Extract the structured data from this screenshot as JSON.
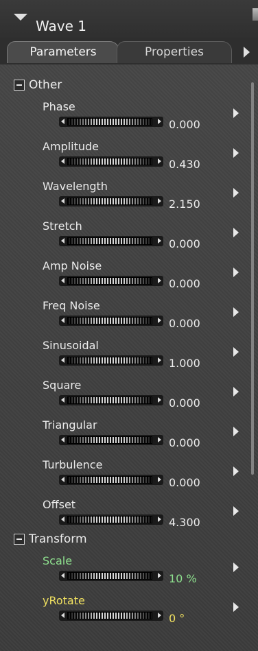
{
  "header": {
    "title": "Wave 1"
  },
  "tabs": [
    {
      "label": "Parameters",
      "active": true
    },
    {
      "label": "Properties",
      "active": false
    }
  ],
  "groups": [
    {
      "label": "Other",
      "params": [
        {
          "label": "Phase",
          "value": "0.000"
        },
        {
          "label": "Amplitude",
          "value": "0.430"
        },
        {
          "label": "Wavelength",
          "value": "2.150"
        },
        {
          "label": "Stretch",
          "value": "0.000"
        },
        {
          "label": "Amp Noise",
          "value": "0.000"
        },
        {
          "label": "Freq Noise",
          "value": "0.000"
        },
        {
          "label": "Sinusoidal",
          "value": "1.000"
        },
        {
          "label": "Square",
          "value": "0.000"
        },
        {
          "label": "Triangular",
          "value": "0.000"
        },
        {
          "label": "Turbulence",
          "value": "0.000"
        },
        {
          "label": "Offset",
          "value": "4.300"
        }
      ]
    },
    {
      "label": "Transform",
      "params": [
        {
          "label": "Scale",
          "value": "10 %",
          "color": "#8ee08e"
        },
        {
          "label": "yRotate",
          "value": "0 °",
          "color": "#f0e060"
        }
      ]
    }
  ]
}
